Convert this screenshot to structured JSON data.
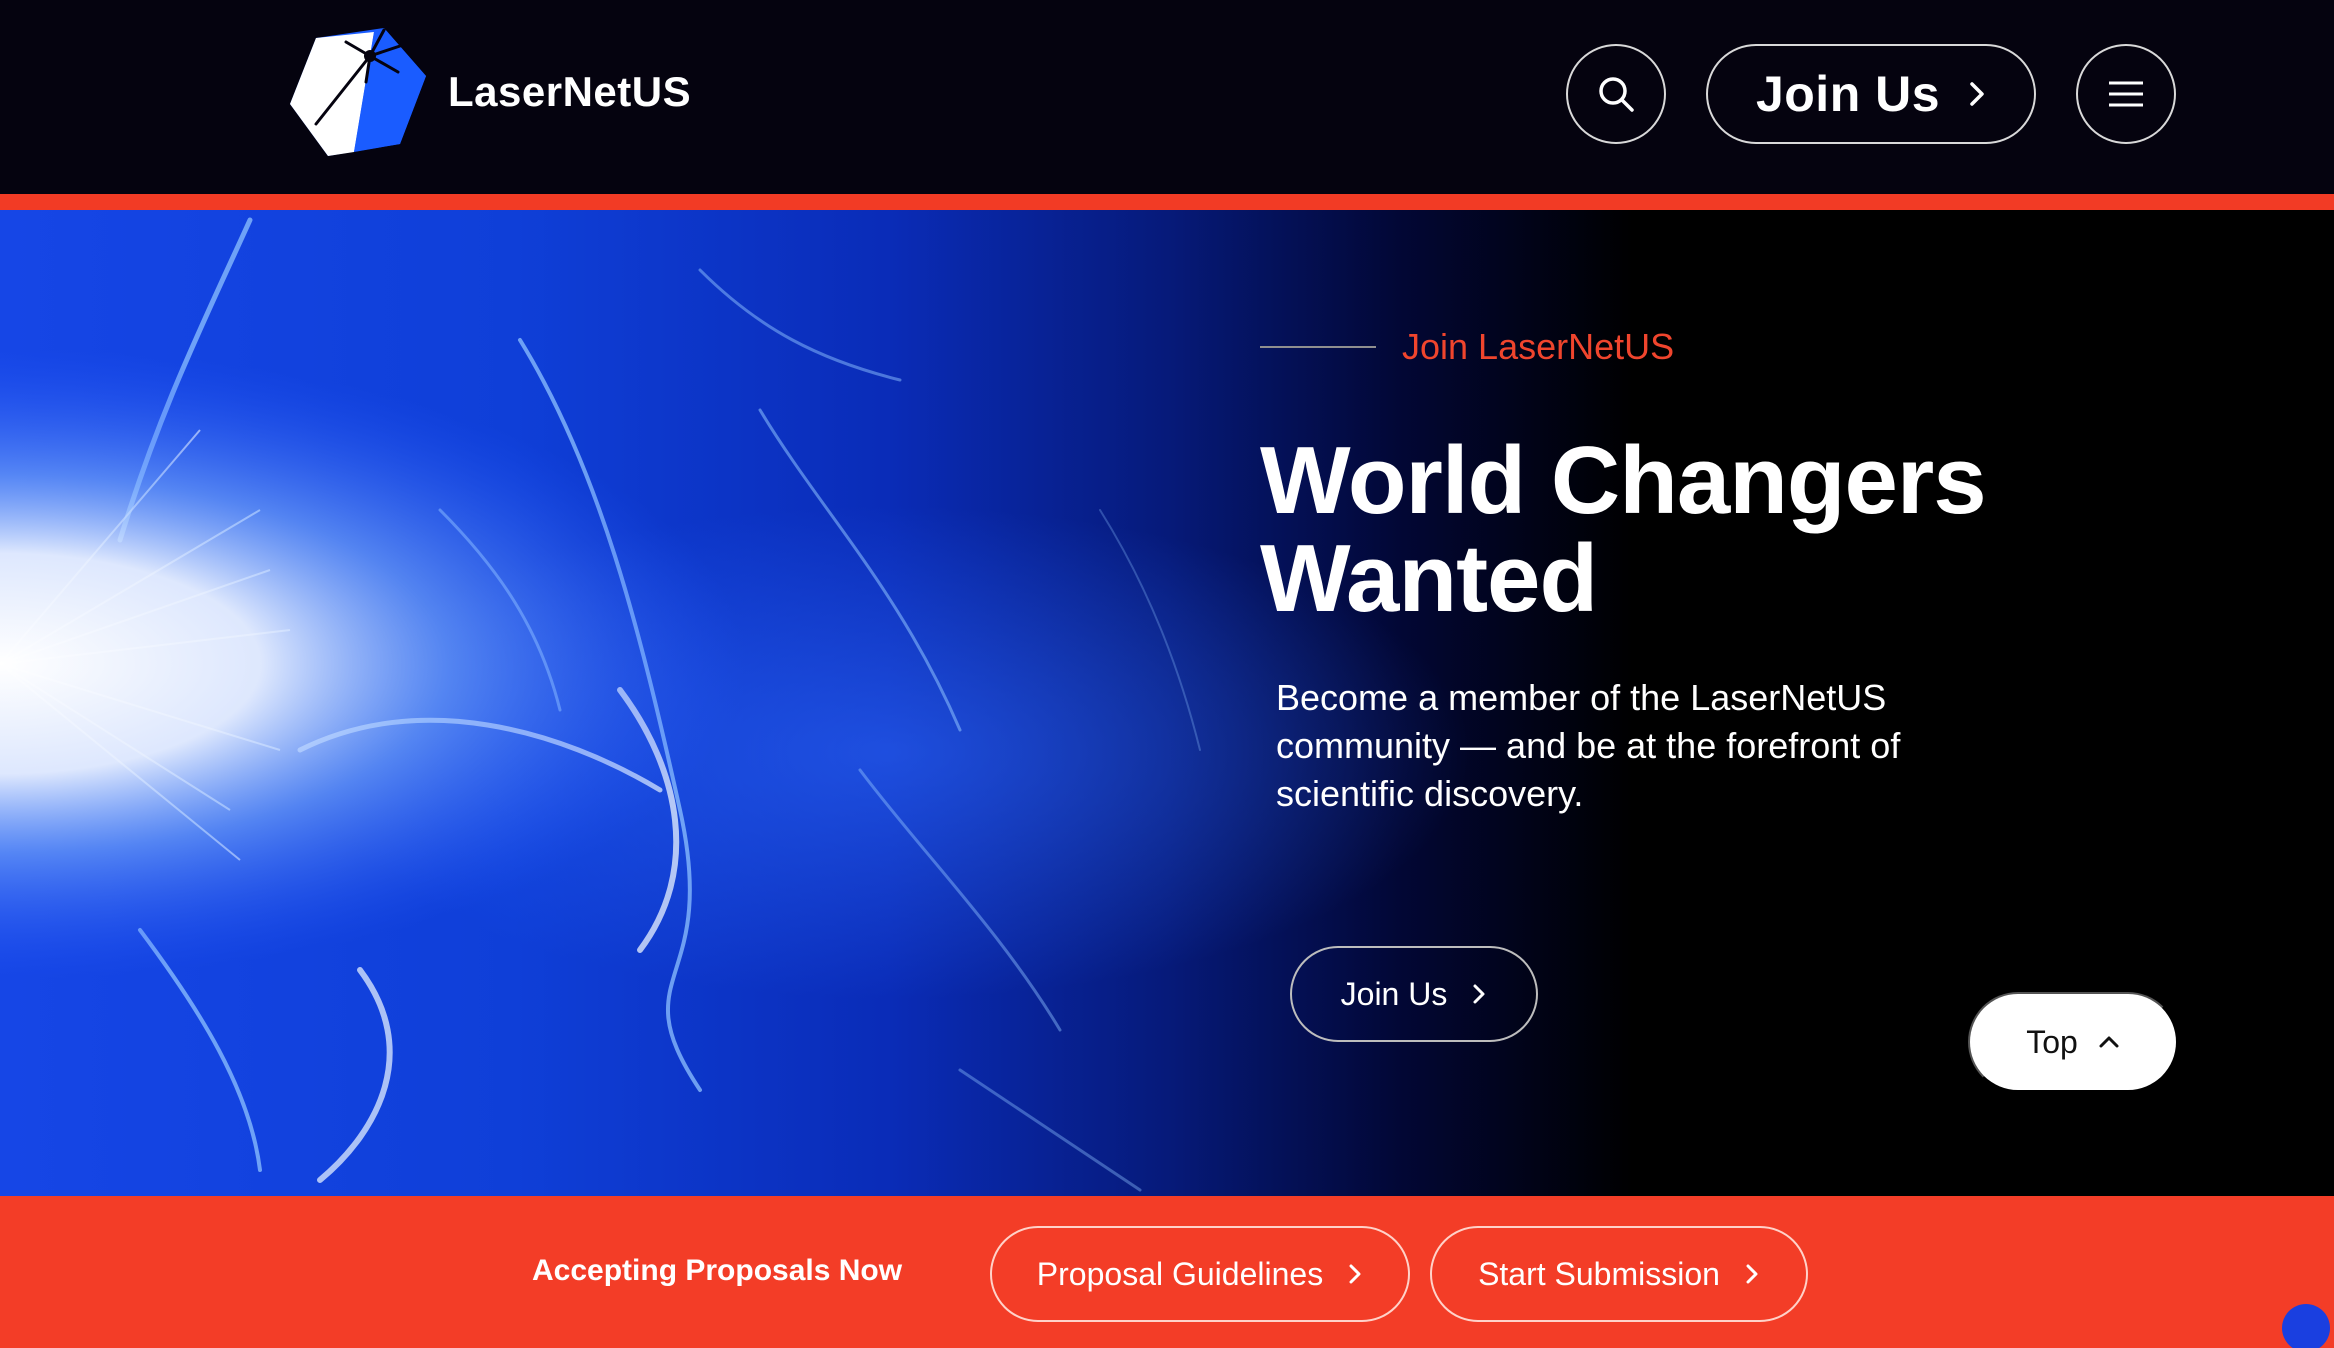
{
  "brand": {
    "name": "LaserNetUS",
    "logo_icon": "lasernetus-logo-icon"
  },
  "header": {
    "search_icon": "search-icon",
    "join_label": "Join Us",
    "menu_icon": "hamburger-menu-icon"
  },
  "hero": {
    "eyebrow": "Join LaserNetUS",
    "title_line1": "World Changers",
    "title_line2": "Wanted",
    "body": "Become a member of the LaserNetUS community — and be at the forefront of scientific discovery.",
    "cta_label": "Join Us"
  },
  "top_button": {
    "label": "Top"
  },
  "proposals": {
    "label": "Accepting Proposals Now",
    "guidelines_label": "Proposal Guidelines",
    "submission_label": "Start Submission"
  },
  "colors": {
    "accent_red": "#f33d27",
    "header_bg": "#05030f",
    "brand_blue": "#1a5cff"
  }
}
